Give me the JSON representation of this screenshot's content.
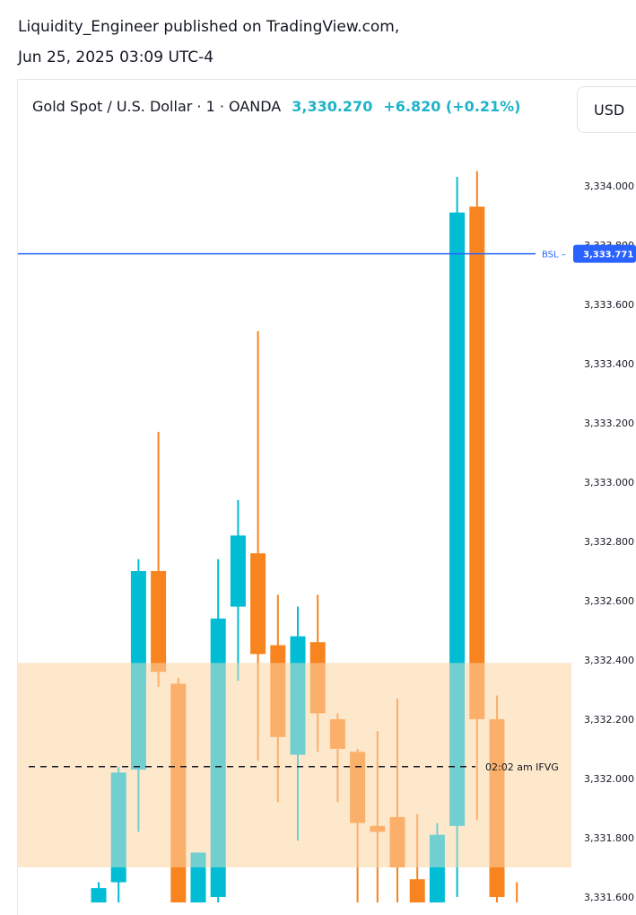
{
  "header": {
    "publisher_line": "Liquidity_Engineer published on TradingView.com,",
    "date_line": "Jun 25, 2025 03:09 UTC-4"
  },
  "legend": {
    "title": "Gold Spot / U.S. Dollar · 1 · OANDA",
    "price": "3,330.270",
    "change": "+6.820 (+0.21%)"
  },
  "toolbar": {
    "currency_label": "USD"
  },
  "colors": {
    "up": "#00bcd4",
    "down": "#f7841e",
    "zone": "#fde7c9",
    "bsl_line": "#2962ff",
    "bsl_badge": "#2962ff"
  },
  "chart_data": {
    "type": "candlestick",
    "ylim": [
      3331.58,
      3334.1
    ],
    "y_ticks": [
      {
        "value": 3334.0,
        "label": "3,334.000"
      },
      {
        "value": 3333.6,
        "label": "3,333.600"
      },
      {
        "value": 3333.4,
        "label": "3,333.400"
      },
      {
        "value": 3333.2,
        "label": "3,333.200"
      },
      {
        "value": 3333.0,
        "label": "3,333.000"
      },
      {
        "value": 3332.8,
        "label": "3,332.800"
      },
      {
        "value": 3332.6,
        "label": "3,332.600"
      },
      {
        "value": 3332.4,
        "label": "3,332.400"
      },
      {
        "value": 3332.2,
        "label": "3,332.200"
      },
      {
        "value": 3332.0,
        "label": "3,332.000"
      },
      {
        "value": 3331.8,
        "label": "3,331.800"
      },
      {
        "value": 3331.6,
        "label": "3,331.600"
      }
    ],
    "candles": [
      {
        "o": 3331.4,
        "h": 3331.65,
        "l": 3331.3,
        "c": 3331.63
      },
      {
        "o": 3331.65,
        "h": 3332.04,
        "l": 3331.56,
        "c": 3332.02
      },
      {
        "o": 3332.03,
        "h": 3332.74,
        "l": 3331.82,
        "c": 3332.7
      },
      {
        "o": 3332.7,
        "h": 3333.17,
        "l": 3332.31,
        "c": 3332.36
      },
      {
        "o": 3332.32,
        "h": 3332.34,
        "l": 3331.4,
        "c": 3331.45
      },
      {
        "o": 3331.45,
        "h": 3331.75,
        "l": 3331.3,
        "c": 3331.75
      },
      {
        "o": 3331.6,
        "h": 3332.74,
        "l": 3331.4,
        "c": 3332.54
      },
      {
        "o": 3332.58,
        "h": 3332.94,
        "l": 3332.33,
        "c": 3332.82
      },
      {
        "o": 3332.76,
        "h": 3333.51,
        "l": 3332.06,
        "c": 3332.42
      },
      {
        "o": 3332.45,
        "h": 3332.62,
        "l": 3331.92,
        "c": 3332.14
      },
      {
        "o": 3332.08,
        "h": 3332.58,
        "l": 3331.79,
        "c": 3332.48
      },
      {
        "o": 3332.46,
        "h": 3332.62,
        "l": 3332.09,
        "c": 3332.22
      },
      {
        "o": 3332.2,
        "h": 3332.22,
        "l": 3331.92,
        "c": 3332.1
      },
      {
        "o": 3332.09,
        "h": 3332.1,
        "l": 3331.5,
        "c": 3331.85
      },
      {
        "o": 3331.84,
        "h": 3332.16,
        "l": 3331.55,
        "c": 3331.82
      },
      {
        "o": 3331.87,
        "h": 3332.27,
        "l": 3331.55,
        "c": 3331.7
      },
      {
        "o": 3331.66,
        "h": 3331.88,
        "l": 3331.5,
        "c": 3331.58
      },
      {
        "o": 3331.58,
        "h": 3331.85,
        "l": 3331.5,
        "c": 3331.81
      },
      {
        "o": 3331.84,
        "h": 3334.03,
        "l": 3331.6,
        "c": 3333.91
      },
      {
        "o": 3333.93,
        "h": 3334.05,
        "l": 3331.86,
        "c": 3332.2
      },
      {
        "o": 3332.2,
        "h": 3332.28,
        "l": 3331.5,
        "c": 3331.6
      },
      {
        "o": 3331.54,
        "h": 3331.65,
        "l": 3331.5,
        "c": 3331.52
      }
    ],
    "zones": [
      {
        "from": 3331.7,
        "to": 3332.39
      }
    ],
    "levels": [
      {
        "value": 3333.771,
        "label": "BSL",
        "badge": "3,333.771",
        "style": "solid"
      },
      {
        "value": 3332.04,
        "label": "02:02 am IFVG",
        "style": "dashed"
      }
    ]
  }
}
